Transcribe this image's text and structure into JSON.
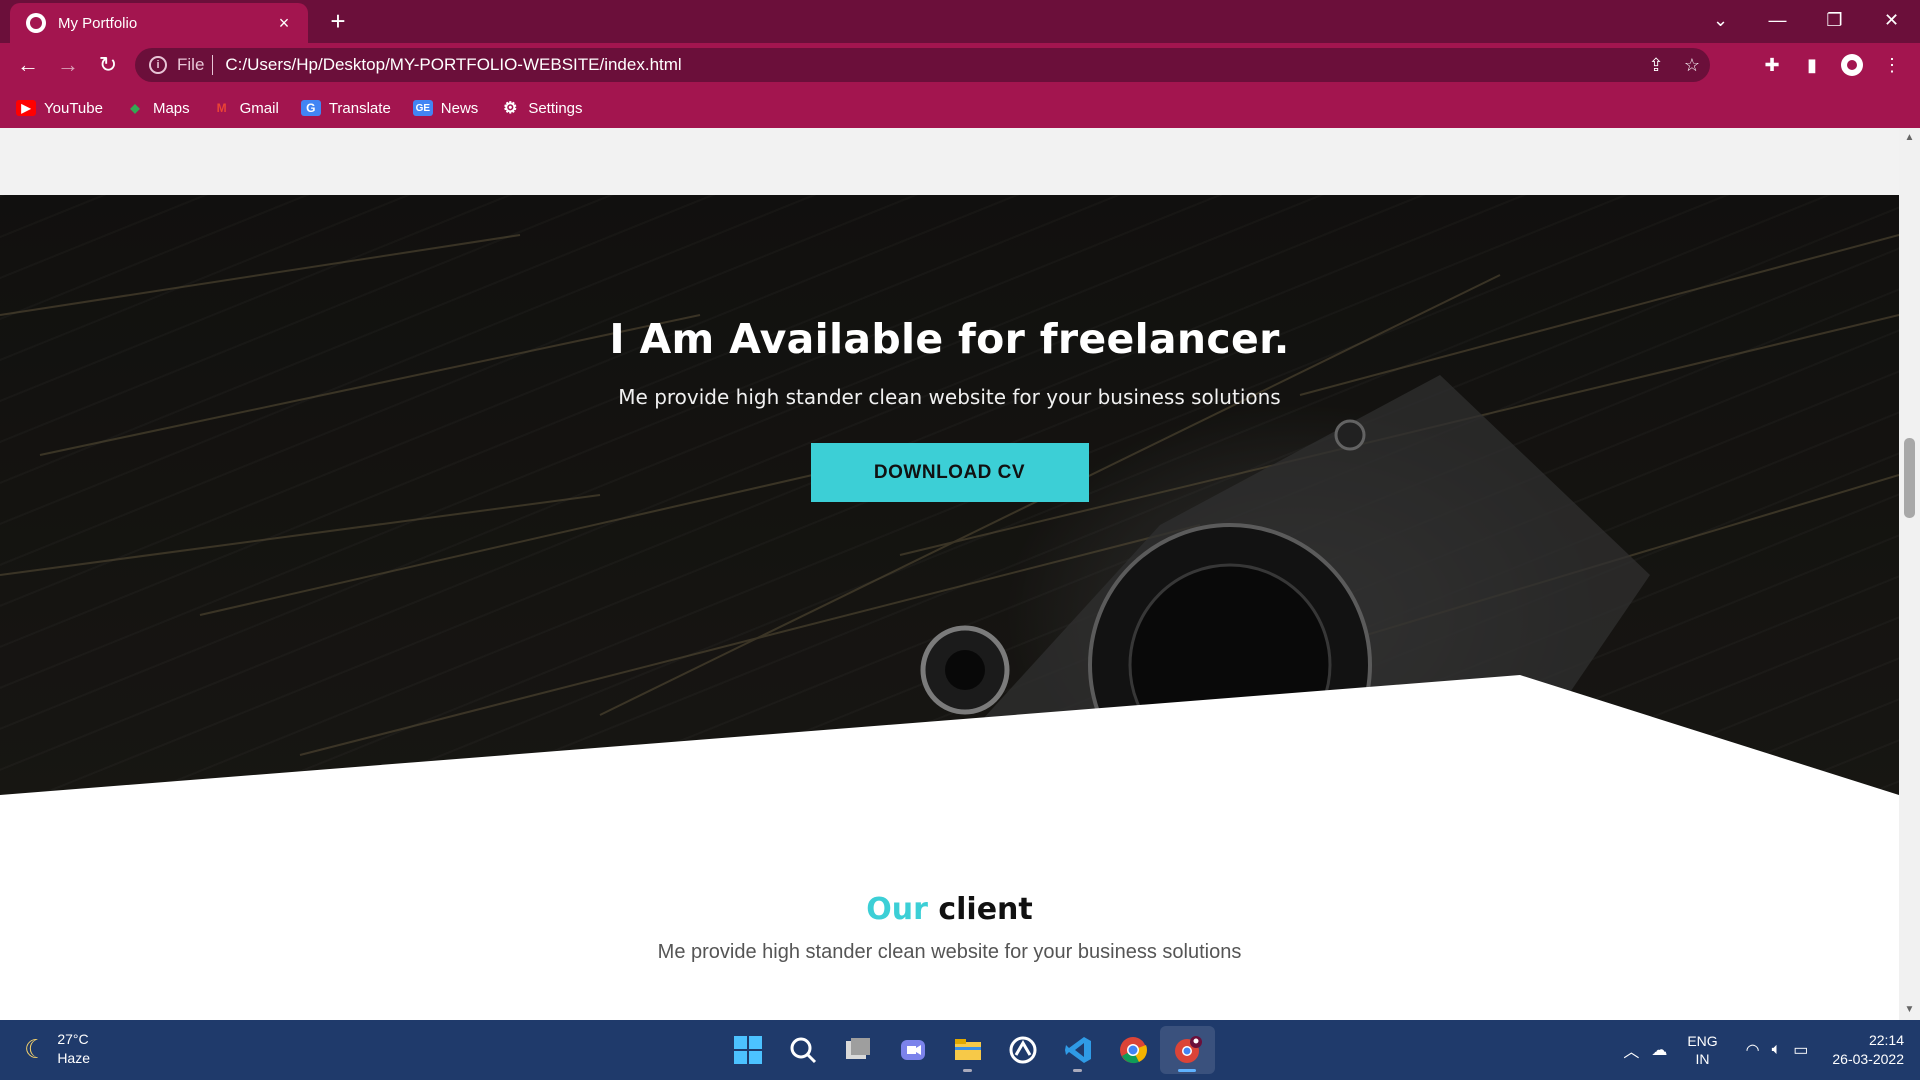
{
  "browser": {
    "tab_title": "My Portfolio",
    "tab_close": "×",
    "new_tab": "+",
    "window_controls": {
      "dropdown": "⌄",
      "minimize": "—",
      "restore": "❐",
      "close": "✕"
    },
    "nav": {
      "back": "←",
      "forward": "→",
      "reload": "↻"
    },
    "address": {
      "scheme_label": "File",
      "url": "C:/Users/Hp/Desktop/MY-PORTFOLIO-WEBSITE/index.html"
    },
    "bookmarks": [
      {
        "label": "YouTube",
        "icon": "youtube-icon",
        "color": "#ff0000"
      },
      {
        "label": "Maps",
        "icon": "maps-icon",
        "color": "#34a853"
      },
      {
        "label": "Gmail",
        "icon": "gmail-icon",
        "color": "#ea4335"
      },
      {
        "label": "Translate",
        "icon": "translate-icon",
        "color": "#4285f4"
      },
      {
        "label": "News",
        "icon": "news-icon",
        "color": "#4285f4"
      },
      {
        "label": "Settings",
        "icon": "gear-icon",
        "color": "#ffffff"
      }
    ]
  },
  "hero": {
    "title": "I Am Available for freelancer.",
    "subtitle": "Me provide high stander clean website for your business solutions",
    "button_label": "DOWNLOAD CV",
    "accent_color": "#3ccfd6"
  },
  "client_section": {
    "title_accent": "Our",
    "title_rest": "client",
    "subtitle": "Me provide high stander clean website for your business solutions"
  },
  "taskbar": {
    "weather": {
      "temp": "27°C",
      "condition": "Haze"
    },
    "apps": [
      {
        "name": "start-icon"
      },
      {
        "name": "search-icon"
      },
      {
        "name": "task-view-icon"
      },
      {
        "name": "teams-chat-icon"
      },
      {
        "name": "file-explorer-icon"
      },
      {
        "name": "store-icon"
      },
      {
        "name": "vscode-icon"
      },
      {
        "name": "chrome-icon"
      },
      {
        "name": "chrome-profile-icon"
      }
    ],
    "lang": {
      "line1": "ENG",
      "line2": "IN"
    },
    "clock": {
      "time": "22:14",
      "date": "26-03-2022"
    }
  }
}
